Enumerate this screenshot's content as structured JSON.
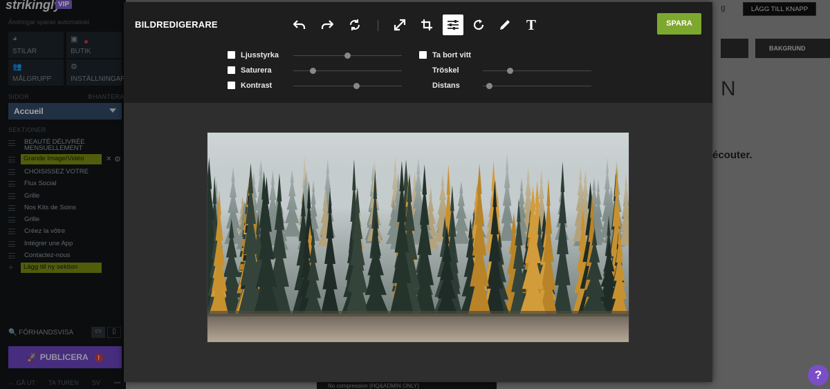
{
  "sidebar": {
    "logo": "strikingly",
    "vip_badge": "VIP",
    "autosave_text": "Ändringar sparas automatiskt.",
    "tiles": [
      {
        "label": "STILAR",
        "icon": "palette-icon"
      },
      {
        "label": "BUTIK",
        "icon": "shopping-bag-icon"
      },
      {
        "label": "MÅLGRUPP",
        "icon": "people-icon"
      },
      {
        "label": "INSTÄLLNINGAR",
        "icon": "gear-icon"
      }
    ],
    "pages_header": "SIDOR",
    "manage_label": "HANTERA",
    "page_select": "Accueil",
    "sections_header": "SEKTIONER",
    "sections": [
      "BEAUTÉ DÉLIVRÉE MENSUELLEMENT",
      "Grande Image/Vidéo",
      "CHOISISSEZ VOTRE",
      "Flux Social",
      "Grille",
      "Nos Kits de Soins",
      "Grille",
      "Créez la vôtre",
      "Intégrer une App",
      "Contactez-nous"
    ],
    "add_section": "Lägg till ny sektion",
    "preview": "FÖRHANDSVISA",
    "publish": "PUBLICERA",
    "footer": [
      "GÅ UT",
      "TA TUREN",
      "SV"
    ]
  },
  "page": {
    "add_button": "LÄGG TILL KNAPP",
    "background_button": "BAKGRUND",
    "background_text": "écouter.",
    "compression_option": "No compression (HQ&ADMIN ONLY)"
  },
  "editor": {
    "title": "BILDREDIGERARE",
    "save": "SPARA",
    "tools": [
      {
        "name": "undo-icon",
        "label": "Ångra"
      },
      {
        "name": "redo-icon",
        "label": "Gör om"
      },
      {
        "name": "reset-icon",
        "label": "Återställ"
      },
      {
        "name": "resize-icon",
        "label": "Storlek"
      },
      {
        "name": "crop-icon",
        "label": "Beskär"
      },
      {
        "name": "adjust-icon",
        "label": "Justera"
      },
      {
        "name": "rotate-icon",
        "label": "Rotera"
      },
      {
        "name": "draw-icon",
        "label": "Rita"
      },
      {
        "name": "text-icon",
        "label": "Text"
      }
    ],
    "adjustments_left": [
      {
        "label": "Ljusstyrka",
        "checked": false,
        "level": 0.5
      },
      {
        "label": "Saturera",
        "checked": false,
        "level": 0.18
      },
      {
        "label": "Kontrast",
        "checked": false,
        "level": 0.58
      }
    ],
    "remove_white": {
      "label": "Ta bort vitt",
      "checked": false
    },
    "adjustments_right": [
      {
        "label": "Tröskel",
        "level": 0.25
      },
      {
        "label": "Distans",
        "level": 0.06
      }
    ],
    "accent_color": "#7da82e"
  },
  "help": "?"
}
